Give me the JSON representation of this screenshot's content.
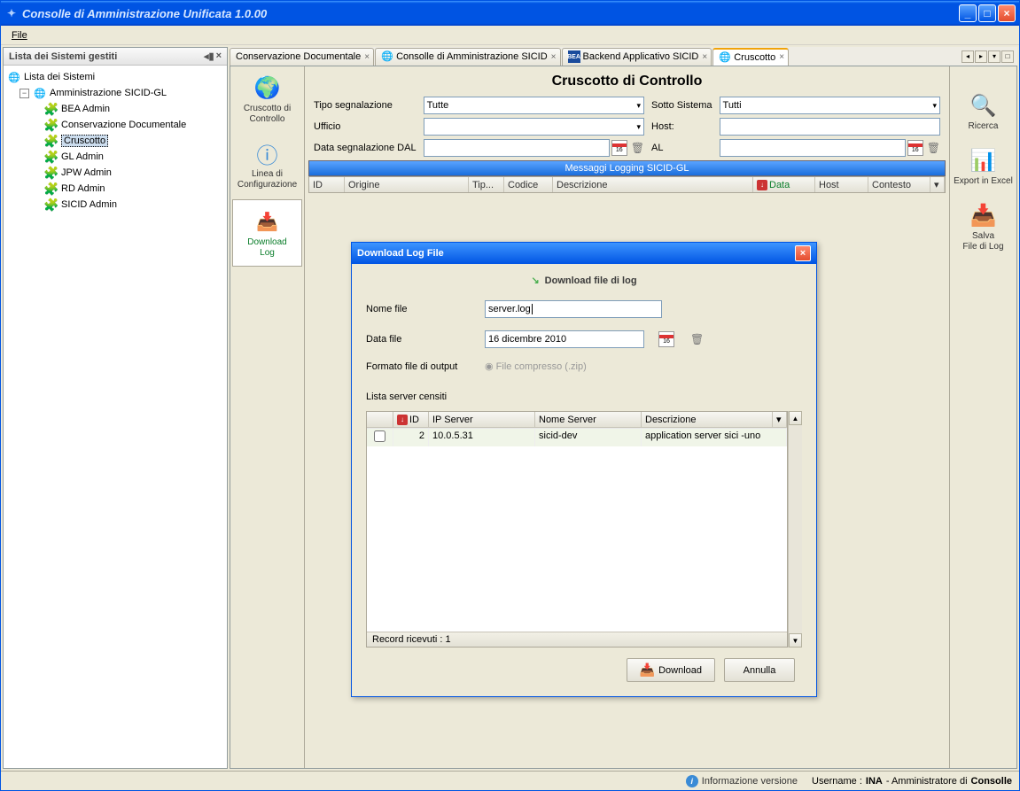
{
  "window": {
    "title": "Consolle di Amministrazione Unificata 1.0.00"
  },
  "menu": {
    "file": "File"
  },
  "sidebar": {
    "header": "Lista dei Sistemi gestiti",
    "root": "Lista dei Sistemi",
    "group": "Amministrazione SICID-GL",
    "items": [
      "BEA Admin",
      "Conservazione Documentale",
      "Cruscotto",
      "GL Admin",
      "JPW Admin",
      "RD Admin",
      "SICID Admin"
    ]
  },
  "tabs": [
    "Conservazione Documentale",
    "Consolle di Amministrazione SICID",
    "Backend Applicativo SICID",
    "Cruscotto"
  ],
  "leftTools": {
    "cruscotto": "Cruscotto di\nControllo",
    "linea": "Linea di\nConfigurazione",
    "download": "Download\nLog"
  },
  "page": {
    "title": "Cruscotto di Controllo",
    "tipo_lbl": "Tipo segnalazione",
    "tipo_val": "Tutte",
    "sotto_lbl": "Sotto Sistema",
    "sotto_val": "Tutti",
    "ufficio_lbl": "Ufficio",
    "host_lbl": "Host:",
    "dal_lbl": "Data segnalazione DAL",
    "al_lbl": "AL"
  },
  "tableTitle": "Messaggi Logging SICID-GL",
  "cols": {
    "id": "ID",
    "origine": "Origine",
    "tipo": "Tip...",
    "codice": "Codice",
    "descr": "Descrizione",
    "data": "Data",
    "host": "Host",
    "contesto": "Contesto"
  },
  "rightTools": {
    "ricerca": "Ricerca",
    "export": "Export in Excel",
    "salva": "Salva\nFile di Log"
  },
  "dialog": {
    "title": "Download Log File",
    "heading": "Download file di log",
    "nome_lbl": "Nome file",
    "nome_val": "server.log",
    "data_lbl": "Data file",
    "data_val": "16 dicembre 2010",
    "formato_lbl": "Formato file di output",
    "formato_val": "File compresso (.zip)",
    "servers_lbl": "Lista server censiti",
    "sh": {
      "id": "ID",
      "ip": "IP Server",
      "nome": "Nome Server",
      "descr": "Descrizione"
    },
    "row": {
      "id": "2",
      "ip": "10.0.5.31",
      "nome": "sicid-dev",
      "descr": "application server sici -uno"
    },
    "record": "Record ricevuti : 1",
    "download_btn": "Download",
    "annulla_btn": "Annulla"
  },
  "status": {
    "info": "Informazione versione",
    "user_lbl": "Username :",
    "user": "INA",
    "role_sep": "- Amministratore di",
    "app": "Consolle"
  }
}
